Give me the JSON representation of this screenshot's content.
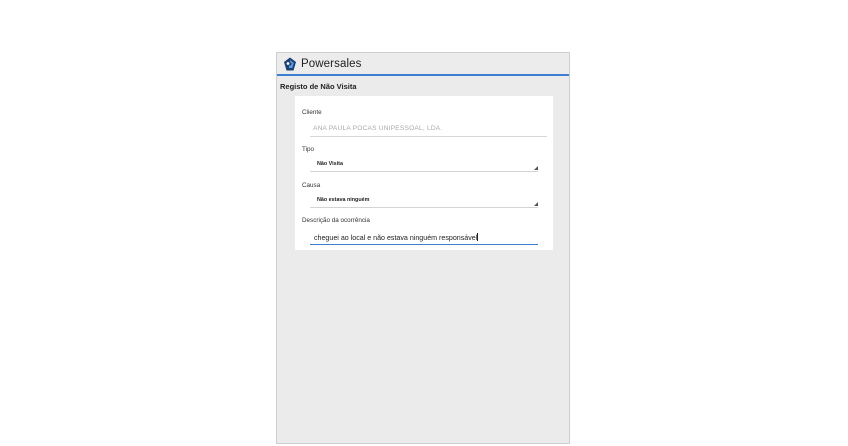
{
  "app": {
    "title": "Powersales",
    "colors": {
      "accent": "#3f7fcf",
      "background": "#ebebeb",
      "card": "#ffffff"
    }
  },
  "screen": {
    "title": "Registo de Não Visita"
  },
  "form": {
    "cliente": {
      "label": "Cliente",
      "value": "ANA PAULA POCAS UNIPESSOAL, LDA."
    },
    "tipo": {
      "label": "Tipo",
      "value": "Não Visita"
    },
    "causa": {
      "label": "Causa",
      "value": "Não estava ninguém"
    },
    "descricao": {
      "label": "Descrição da ocorrência",
      "value": "cheguei ao local e não estava ninguém responsável"
    }
  }
}
